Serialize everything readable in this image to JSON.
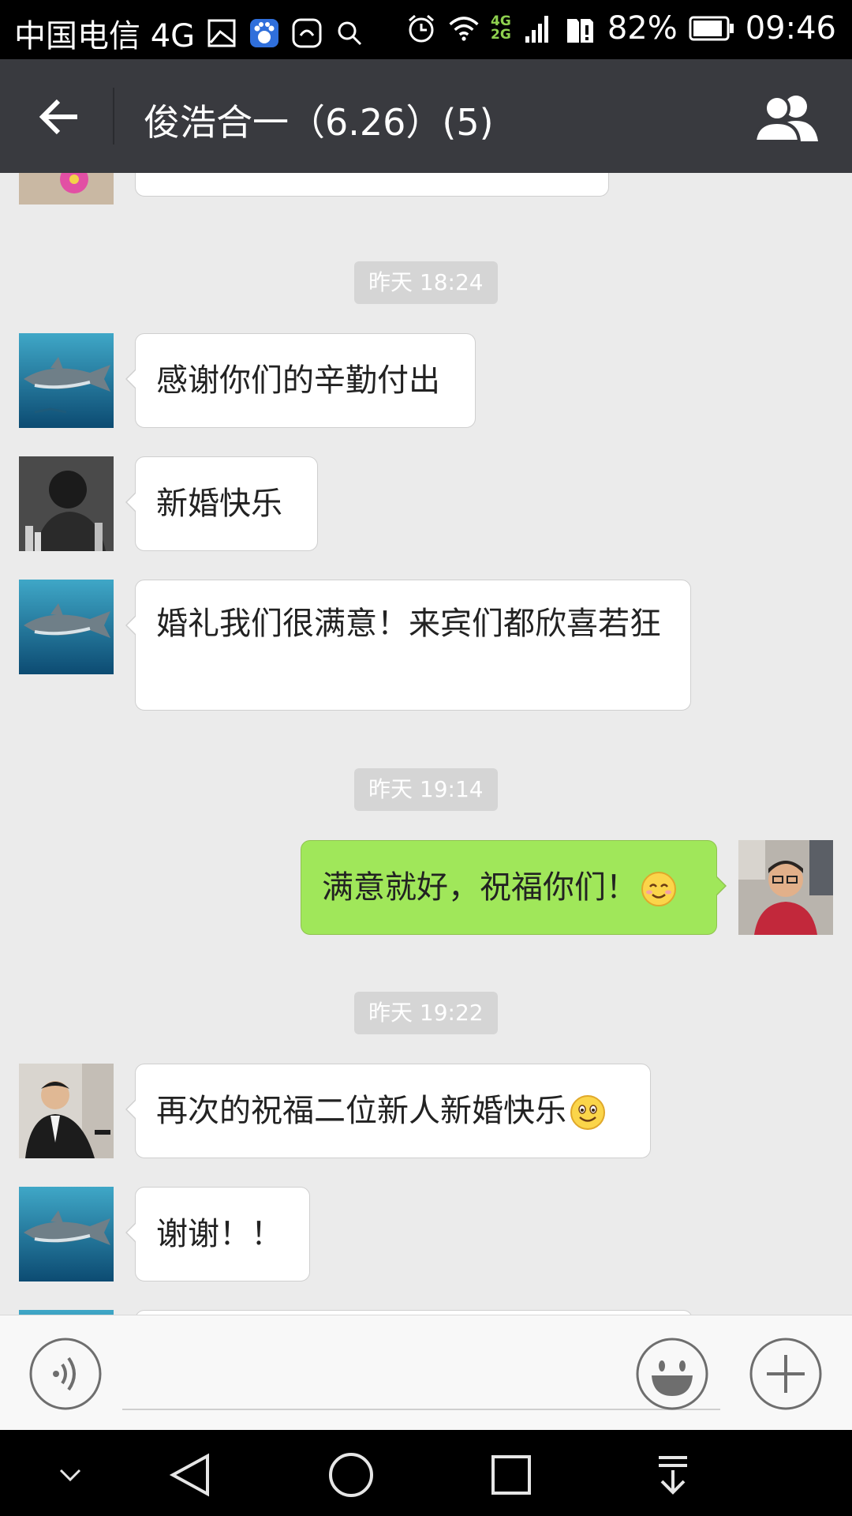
{
  "status_bar": {
    "carrier": "中国电信 4G",
    "net_top": "4G",
    "net_bottom": "2G",
    "battery": "82%",
    "time": "09:46"
  },
  "header": {
    "title": "俊浩合一（6.26）(5)"
  },
  "messages": [
    {
      "type": "time",
      "text": "昨天 18:24"
    },
    {
      "type": "text",
      "side": "left",
      "avatar": "shark",
      "text": "感谢你们的辛勤付出"
    },
    {
      "type": "text",
      "side": "left",
      "avatar": "dark-portrait",
      "text": "新婚快乐"
    },
    {
      "type": "text",
      "side": "left",
      "avatar": "shark",
      "text": "婚礼我们很满意！来宾们都欣喜若狂"
    },
    {
      "type": "time",
      "text": "昨天 19:14"
    },
    {
      "type": "text",
      "side": "right",
      "avatar": "self",
      "text": "满意就好，祝福你们！"
    },
    {
      "type": "time",
      "text": "昨天 19:22"
    },
    {
      "type": "text",
      "side": "left",
      "avatar": "suit-man",
      "text": "再次的祝福二位新人新婚快乐"
    },
    {
      "type": "text",
      "side": "left",
      "avatar": "shark",
      "text": "谢谢！！"
    }
  ],
  "colors": {
    "title_bar": "#393a3f",
    "chat_bg": "#ebebeb",
    "my_bubble": "#a0e75a",
    "their_bubble": "#ffffff"
  },
  "icons": [
    "back-arrow-icon",
    "group-members-icon",
    "voice-icon",
    "emoji-icon",
    "plus-icon",
    "nav-down-icon",
    "nav-back-icon",
    "nav-home-icon",
    "nav-recents-icon",
    "nav-notification-icon"
  ]
}
